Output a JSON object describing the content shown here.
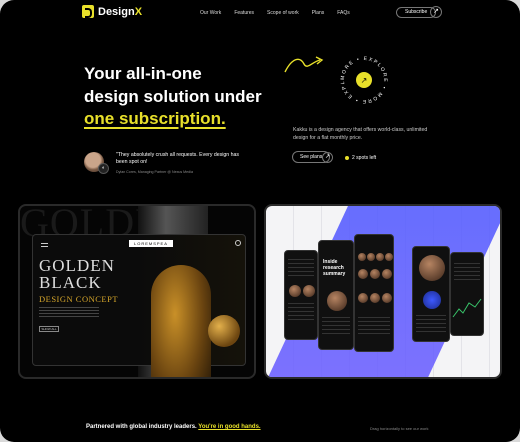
{
  "header": {
    "logo_text": "Design",
    "logo_accent": "X",
    "nav": [
      "Our Work",
      "Features",
      "Scope of work",
      "Plans",
      "FAQs"
    ],
    "subscribe_label": "Subscribe",
    "subscribe_arrow": "↗"
  },
  "hero": {
    "headline_line1": "Your all-in-one",
    "headline_line2": "design solution under",
    "headline_highlight": "one subscription.",
    "testimonial_quote": "\"They absolutely crush all requests. Every design has been spot on!",
    "testimonial_author": "Dylan Cores, Managing Partner @ Nexus Media",
    "badge_text": "MORE • EXPLORE • MORE • EXPLORE •",
    "badge_arrow": "↗",
    "description": "Kakku is a design agency that offers world-class, unlimited design for a flat monthly price.",
    "see_plans_label": "See plans",
    "see_plans_arrow": "↗",
    "spots_label": "2 spots left"
  },
  "showcase": {
    "left": {
      "bg_text": "GOLDEN",
      "label": "LOREMSPEA",
      "title_line1": "GOLDEN",
      "title_line2": "BLACK",
      "subtitle": "DESIGN CONCEPT",
      "button": "SHOW ALL"
    },
    "right": {
      "phone_title": "Inside research summary"
    }
  },
  "footer": {
    "partners_text": "Partnered with global industry leaders.",
    "partners_highlight": "You're in good hands.",
    "drag_hint": "Drag horizontally to see our work"
  },
  "colors": {
    "accent": "#e8e02a",
    "stripe": "#4b56ff",
    "background": "#000000"
  }
}
